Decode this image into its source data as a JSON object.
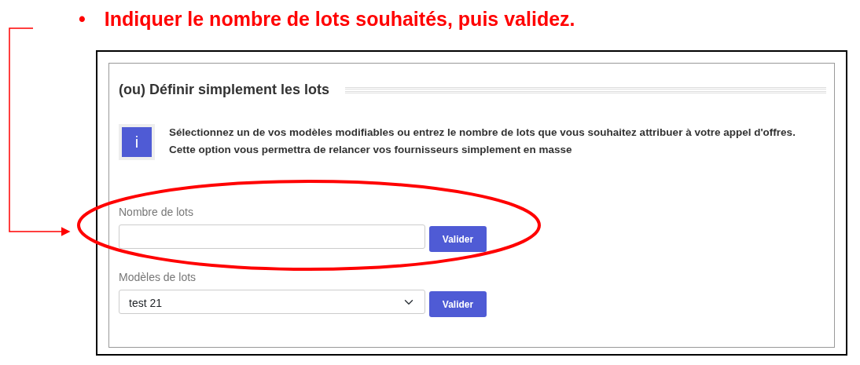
{
  "slide": {
    "bullet": "•",
    "instruction": "Indiquer le nombre de lots souhaités, puis validez."
  },
  "panel": {
    "title": "(ou) Définir simplement les lots",
    "info": {
      "icon_text": "i",
      "lines": [
        "Sélectionnez un de vos modèles modifiables ou entrez le nombre de lots que vous souhaitez attribuer à votre appel d'offres.",
        "Cette option vous permettra de relancer vos fournisseurs simplement en masse"
      ]
    },
    "fields": [
      {
        "kind": "input",
        "label": "Nombre de lots",
        "button": "Valider"
      },
      {
        "kind": "select",
        "label": "Modèles de lots",
        "value": "test 21",
        "button": "Valider"
      }
    ]
  }
}
